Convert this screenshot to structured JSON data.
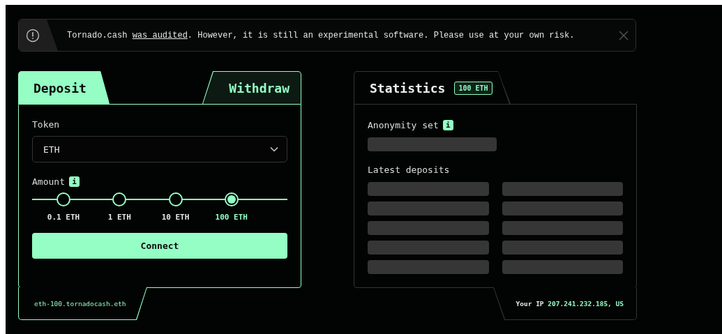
{
  "notice": {
    "text_before": "Tornado.cash ",
    "link": "was audited",
    "text_after": ". However, it is still an experimental software. Please use at your own risk."
  },
  "tabs": [
    {
      "label": "Deposit",
      "selected": true
    },
    {
      "label": "Withdraw",
      "selected": false
    }
  ],
  "token": {
    "label": "Token",
    "value": "ETH"
  },
  "amount": {
    "label": "Amount",
    "info": "i",
    "options": [
      {
        "label": "0.1 ETH",
        "selected": false
      },
      {
        "label": "1 ETH",
        "selected": false
      },
      {
        "label": "10 ETH",
        "selected": false
      },
      {
        "label": "100 ETH",
        "selected": true
      }
    ]
  },
  "connect_button": "Connect",
  "ens_name": "eth-100.tornadocash.eth",
  "statistics": {
    "title": "Statistics",
    "badge": "100 ETH",
    "anonymity_set": {
      "label": "Anonymity set",
      "info": "i",
      "value": {
        "kind": "placeholder"
      }
    },
    "latest_deposits": {
      "label": "Latest deposits",
      "items": [
        {
          "kind": "placeholder"
        },
        {
          "kind": "placeholder"
        },
        {
          "kind": "placeholder"
        },
        {
          "kind": "placeholder"
        },
        {
          "kind": "placeholder"
        },
        {
          "kind": "placeholder"
        },
        {
          "kind": "placeholder"
        },
        {
          "kind": "placeholder"
        },
        {
          "kind": "placeholder"
        },
        {
          "kind": "placeholder"
        }
      ]
    }
  },
  "ip": {
    "label": "Your IP",
    "value": "207.241.232.185, US"
  }
}
